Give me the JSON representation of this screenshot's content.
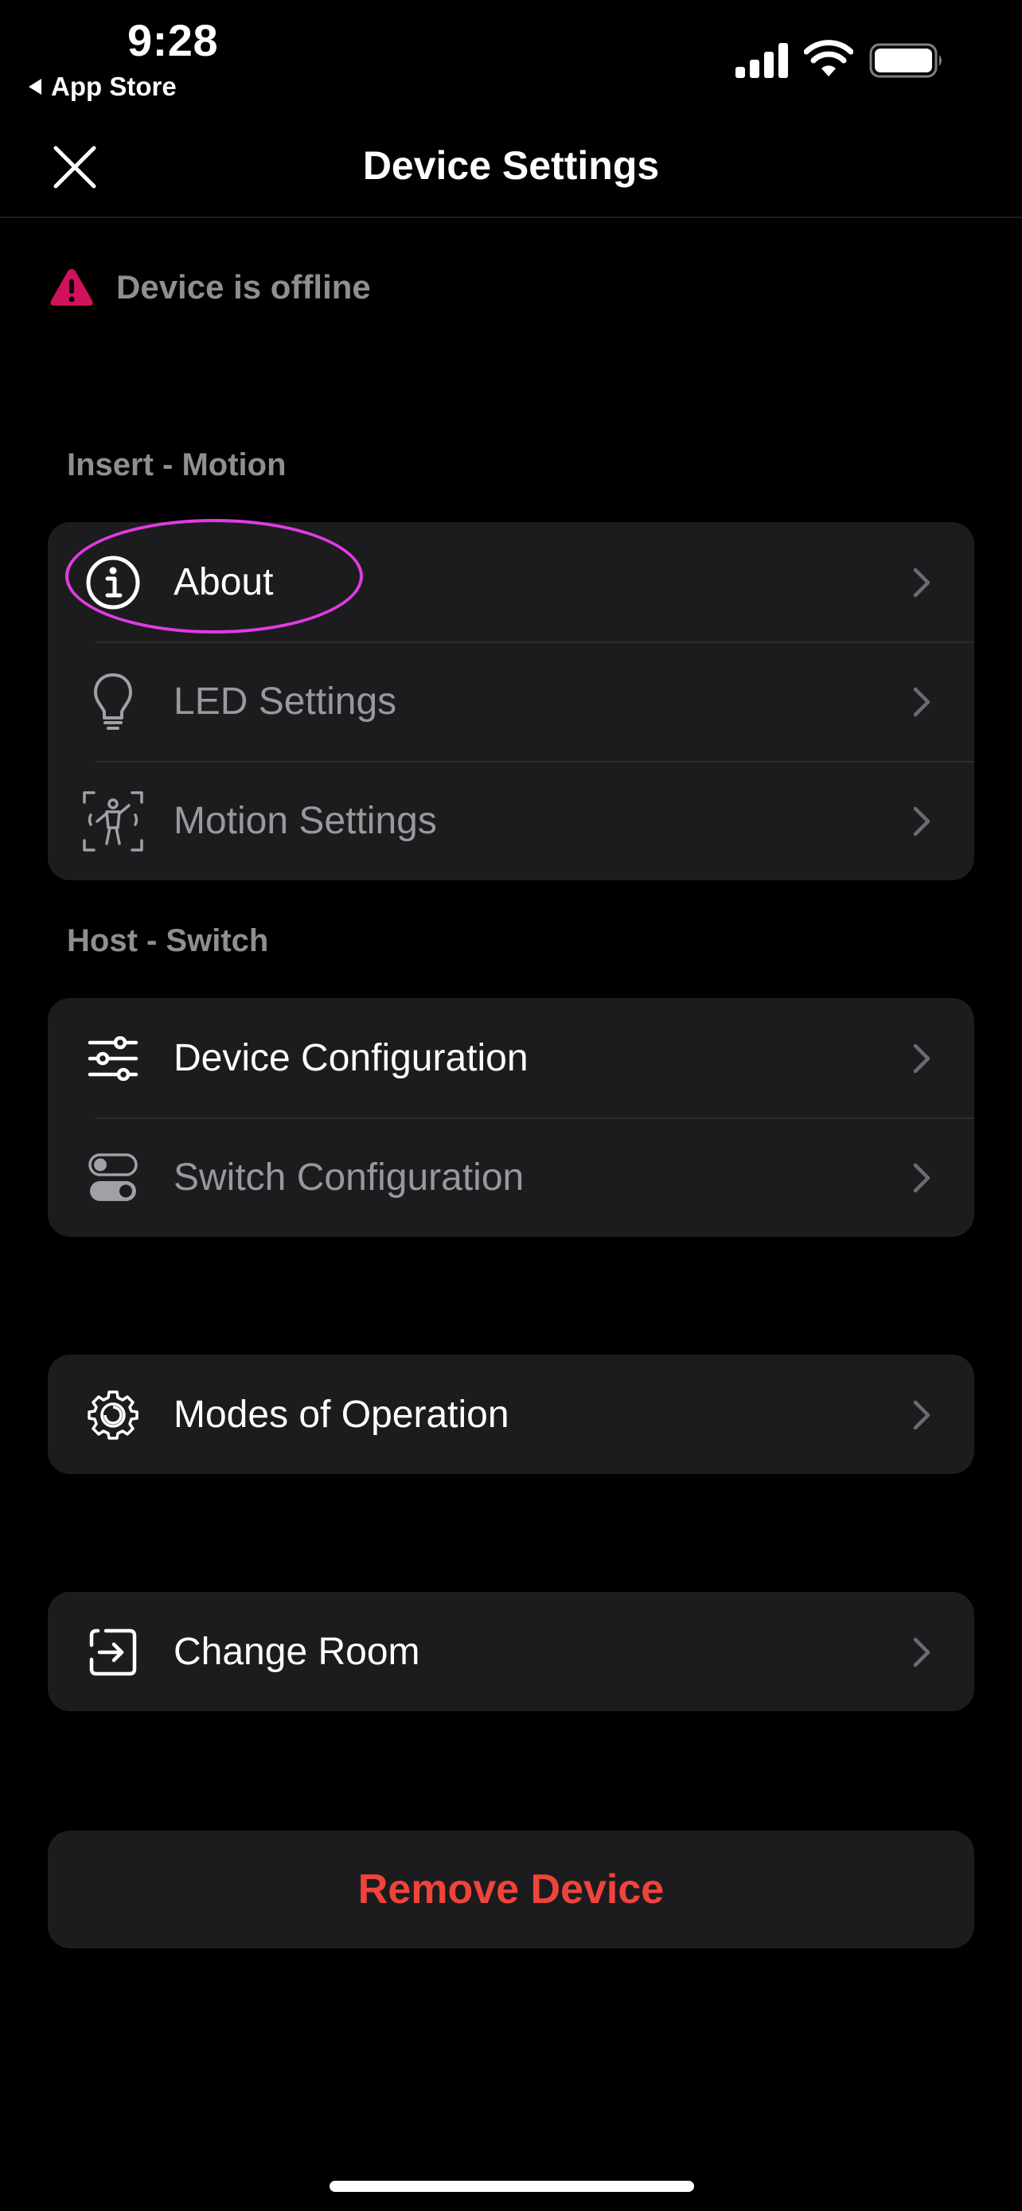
{
  "status_bar": {
    "time": "9:28",
    "back_label": "App Store"
  },
  "header": {
    "title": "Device Settings"
  },
  "offline_notice": {
    "text": "Device is offline",
    "color": "#d0115c"
  },
  "sections": [
    {
      "label": "Insert - Motion",
      "items": [
        {
          "label": "About",
          "icon": "info-icon",
          "enabled": true
        },
        {
          "label": "LED Settings",
          "icon": "lightbulb-icon",
          "enabled": false
        },
        {
          "label": "Motion Settings",
          "icon": "motion-sensor-icon",
          "enabled": false
        }
      ]
    },
    {
      "label": "Host - Switch",
      "items": [
        {
          "label": "Device Configuration",
          "icon": "sliders-icon",
          "enabled": true
        },
        {
          "label": "Switch Configuration",
          "icon": "toggle-icon",
          "enabled": false
        }
      ]
    }
  ],
  "modes": {
    "label": "Modes of Operation",
    "icon": "gear-icon"
  },
  "change_room": {
    "label": "Change Room",
    "icon": "enter-room-icon"
  },
  "remove_device": {
    "label": "Remove Device",
    "color": "#f0443a"
  },
  "highlight_color": "#e23be3"
}
